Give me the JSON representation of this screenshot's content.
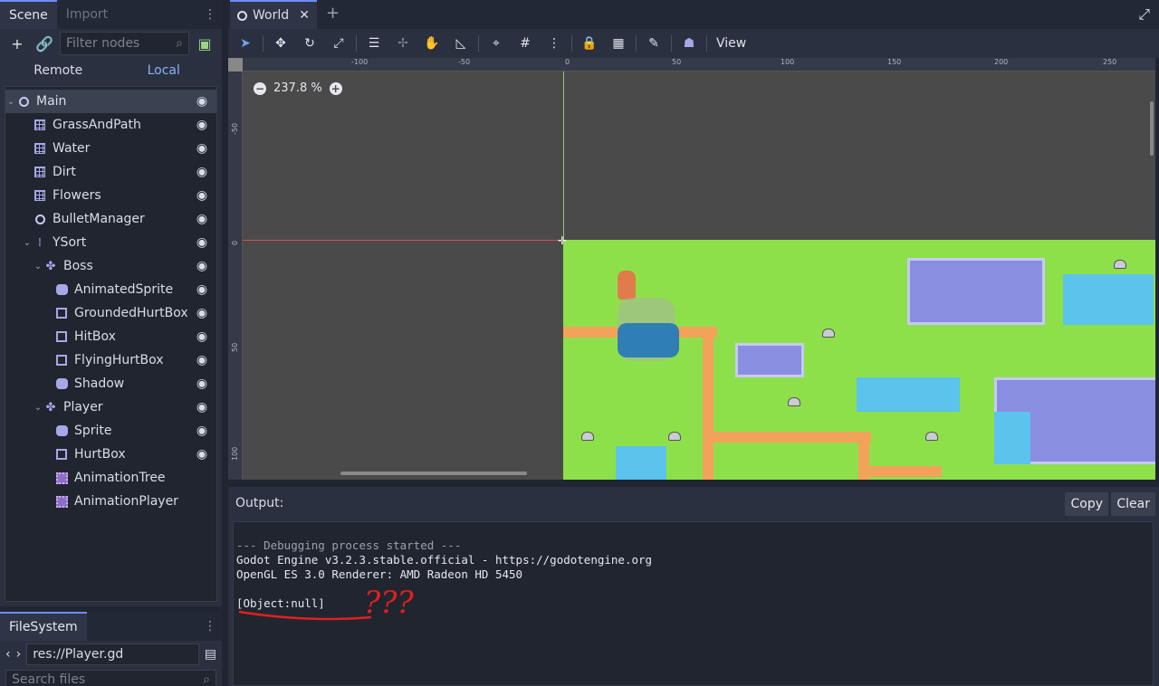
{
  "scene_dock": {
    "tabs": [
      "Scene",
      "Import"
    ],
    "filter_placeholder": "Filter nodes",
    "remote_label": "Remote",
    "local_label": "Local",
    "nodes": [
      {
        "label": "Main",
        "icon": "node-icon"
      },
      {
        "label": "GrassAndPath",
        "icon": "tilemap-icon"
      },
      {
        "label": "Water",
        "icon": "tilemap-icon"
      },
      {
        "label": "Dirt",
        "icon": "tilemap-icon"
      },
      {
        "label": "Flowers",
        "icon": "tilemap-icon"
      },
      {
        "label": "BulletManager",
        "icon": "node-icon"
      },
      {
        "label": "YSort",
        "icon": "ysort-icon"
      },
      {
        "label": "Boss",
        "icon": "kinematic-body-icon"
      },
      {
        "label": "AnimatedSprite",
        "icon": "sprite-icon"
      },
      {
        "label": "GroundedHurtBox",
        "icon": "area-icon"
      },
      {
        "label": "HitBox",
        "icon": "area-icon"
      },
      {
        "label": "FlyingHurtBox",
        "icon": "area-icon"
      },
      {
        "label": "Shadow",
        "icon": "sprite-icon"
      },
      {
        "label": "Player",
        "icon": "kinematic-body-icon"
      },
      {
        "label": "Sprite",
        "icon": "sprite-icon"
      },
      {
        "label": "HurtBox",
        "icon": "area-icon"
      },
      {
        "label": "AnimationTree",
        "icon": "animation-tree-icon"
      },
      {
        "label": "AnimationPlayer",
        "icon": "animation-player-icon"
      }
    ]
  },
  "filesystem_dock": {
    "tab": "FileSystem",
    "path": "res://Player.gd",
    "search_placeholder": "Search files"
  },
  "editor": {
    "scene_tab": "World",
    "view_menu": "View",
    "zoom": "237.8 %",
    "ruler_top": [
      "-100",
      "-50",
      "0",
      "50",
      "100",
      "150",
      "200",
      "250"
    ],
    "ruler_left": [
      "-50",
      "0",
      "50",
      "100"
    ]
  },
  "output": {
    "title": "Output:",
    "copy_label": "Copy",
    "clear_label": "Clear",
    "lines": [
      "--- Debugging process started ---",
      "Godot Engine v3.2.3.stable.official - https://godotengine.org",
      "OpenGL ES 3.0 Renderer: AMD Radeon HD 5450",
      "",
      "[Object:null]"
    ],
    "annotation": "??? "
  },
  "colors": {
    "accent": "#6b8cff",
    "grass": "#8ee04a",
    "water": "#5bc3ec",
    "path": "#f3a25a",
    "annotation_red": "#e02020"
  }
}
